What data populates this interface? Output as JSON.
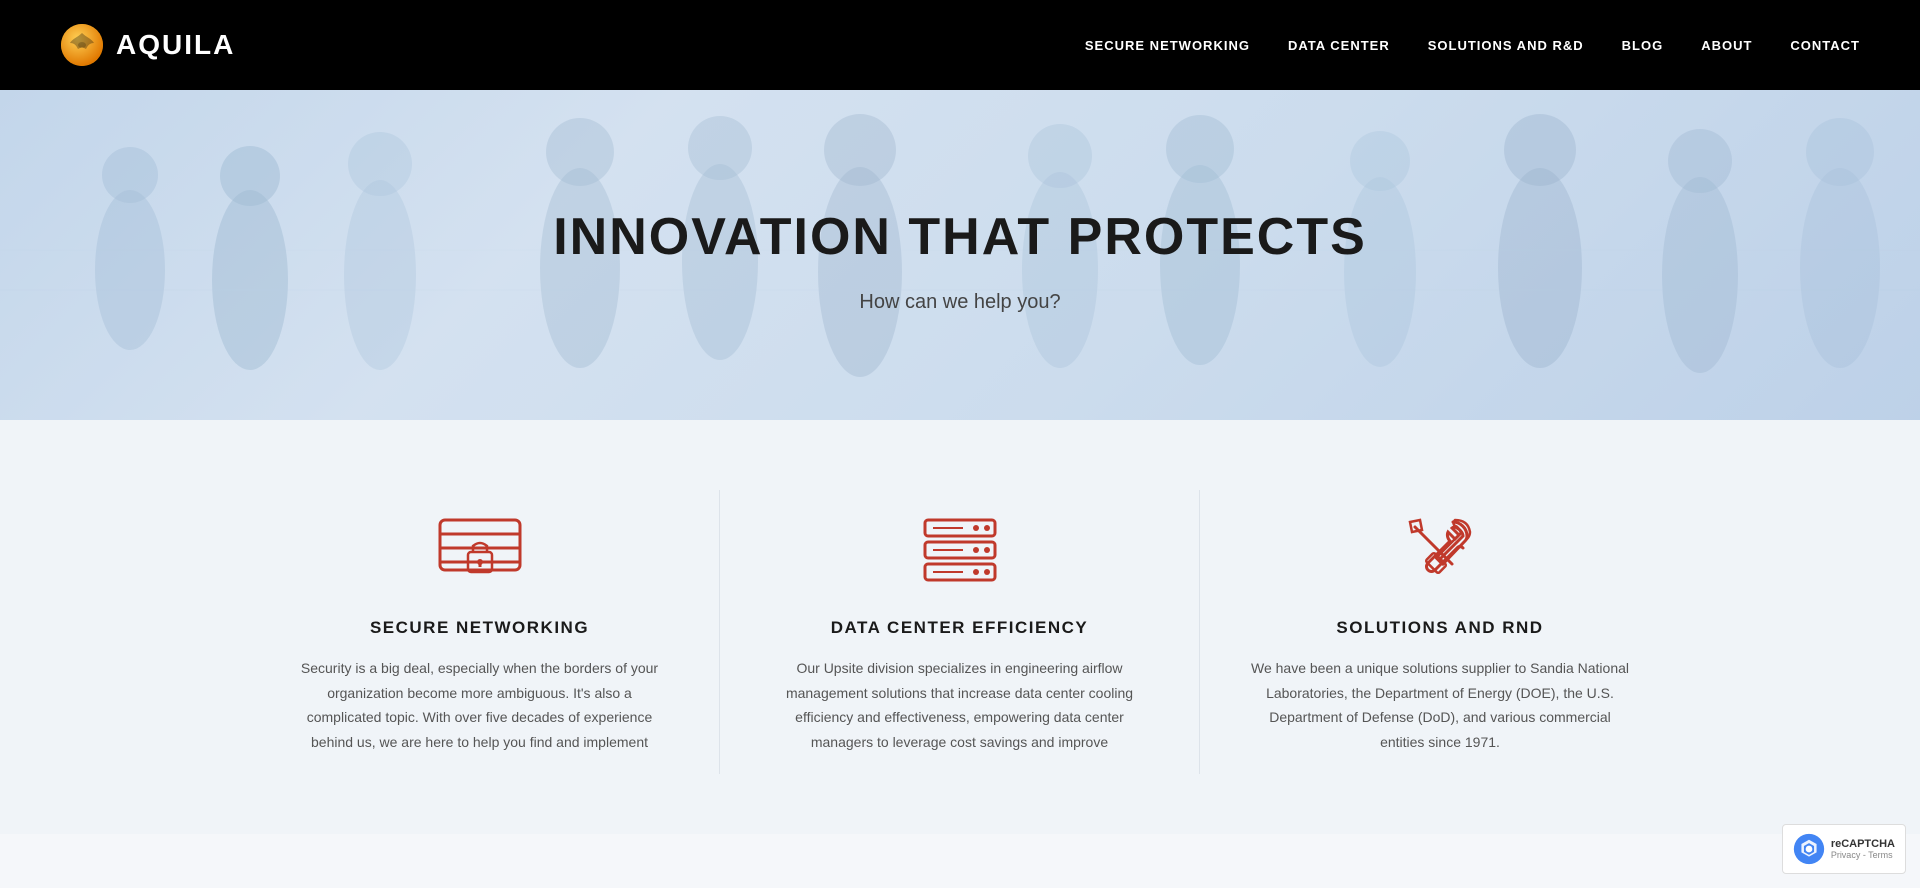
{
  "header": {
    "logo_text": "AQUILA",
    "nav_items": [
      {
        "label": "SECURE NETWORKING",
        "id": "secure-networking"
      },
      {
        "label": "DATA CENTER",
        "id": "data-center"
      },
      {
        "label": "SOLUTIONS AND R&D",
        "id": "solutions-rnd"
      },
      {
        "label": "BLOG",
        "id": "blog"
      },
      {
        "label": "ABOUT",
        "id": "about"
      },
      {
        "label": "CONTACT",
        "id": "contact"
      }
    ]
  },
  "hero": {
    "title": "INNOVATION THAT PROTECTS",
    "subtitle": "How can we help you?"
  },
  "features": [
    {
      "id": "secure-networking",
      "title": "SECURE NETWORKING",
      "description": "Security is a big deal, especially when the borders of your organization become more ambiguous. It's also a complicated topic. With over five decades of experience behind us, we are here to help you find and implement",
      "icon": "shield-lock"
    },
    {
      "id": "data-center-efficiency",
      "title": "DATA CENTER EFFICIENCY",
      "description": "Our Upsite division specializes in engineering airflow management solutions that increase data center cooling efficiency and effectiveness, empowering data center managers to leverage cost savings and improve",
      "icon": "server-stack"
    },
    {
      "id": "solutions-rnd",
      "title": "SOLUTIONS AND RND",
      "description": "We have been a unique solutions supplier to Sandia National Laboratories, the Department of Energy (DOE), the U.S. Department of Defense (DoD), and various commercial entities since 1971.",
      "icon": "tools-wrench"
    }
  ],
  "recaptcha": {
    "text": "reCAPTCHA",
    "subtext": "Privacy - Terms"
  },
  "colors": {
    "accent": "#c0392b",
    "icon_red": "#c0392b",
    "header_bg": "#000000",
    "hero_bg": "#cdd8e8"
  }
}
